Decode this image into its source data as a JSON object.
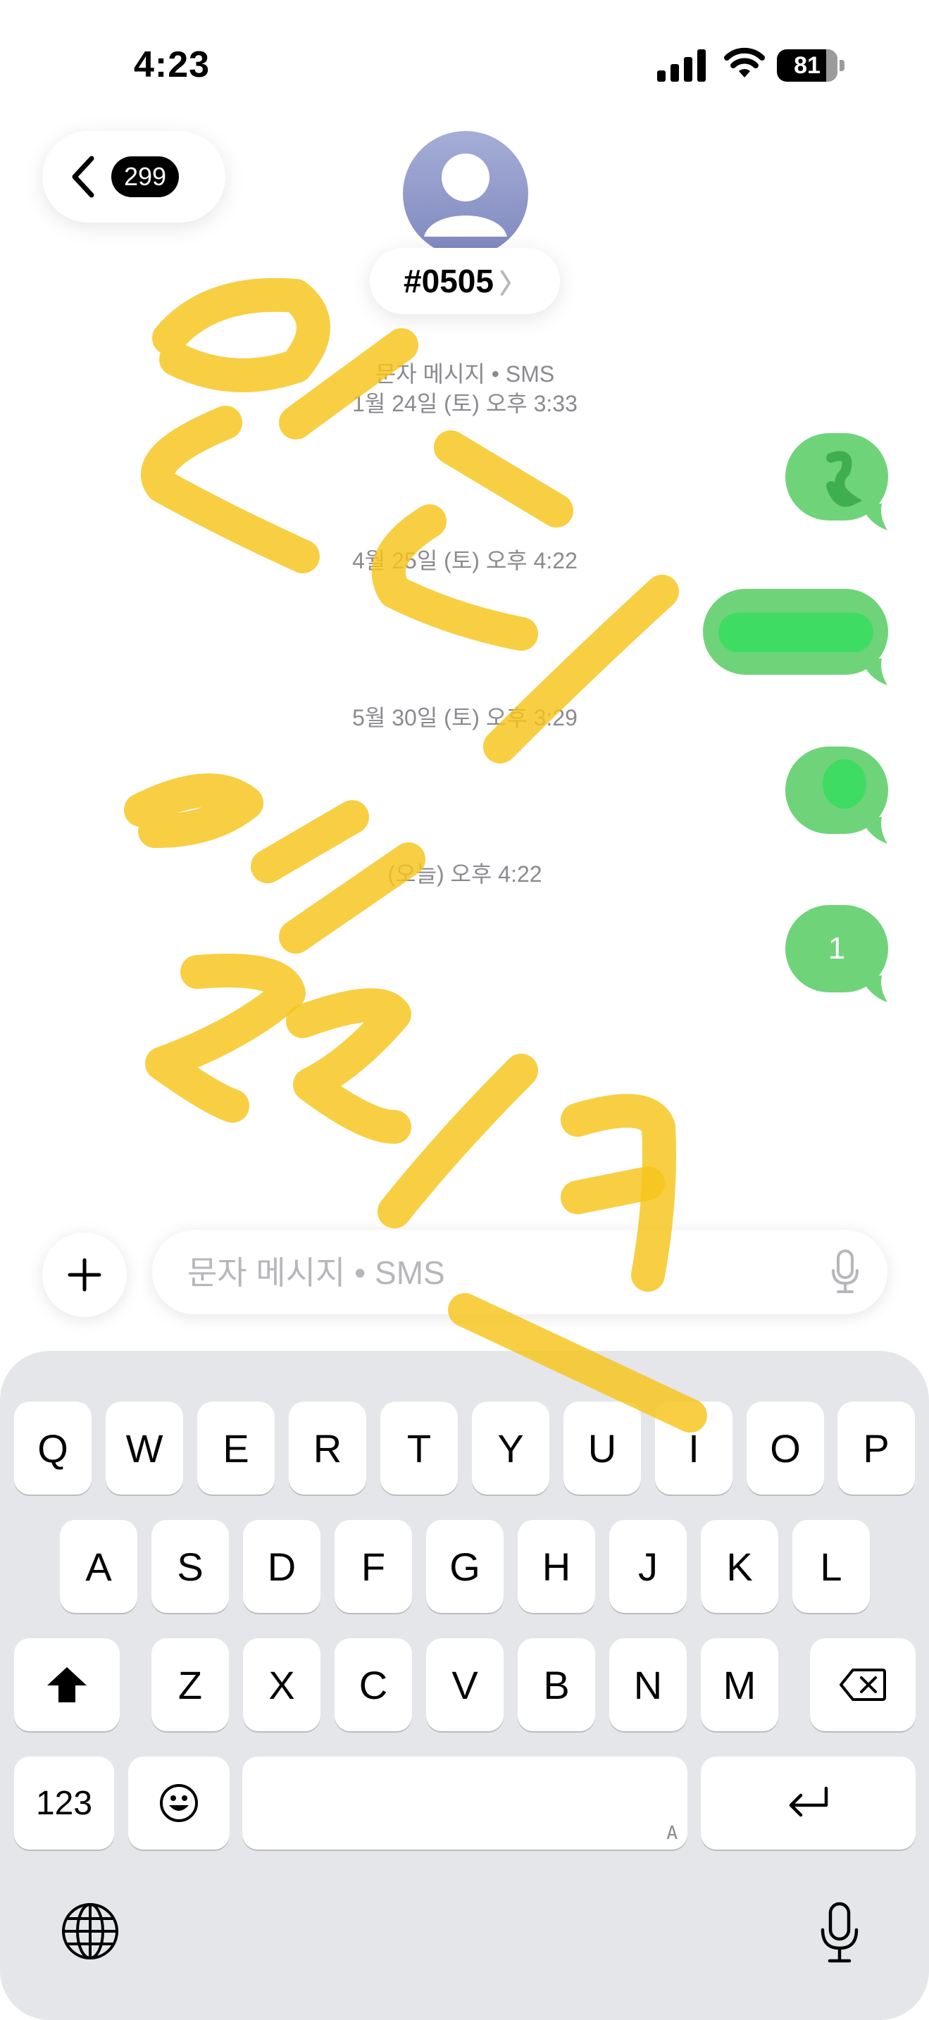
{
  "status_bar": {
    "time": "4:23",
    "battery_level": "81",
    "battery_fraction": 0.81
  },
  "header": {
    "back_badge_count": "299",
    "contact_name": "#0505",
    "contact_chevron": "〉"
  },
  "thread": {
    "timestamps": [
      {
        "line1": "문자 메시지 • SMS",
        "line2": "1월 24일 (토) 오후 3:33"
      },
      {
        "line1": "4월 25일 (토) 오후 4:22"
      },
      {
        "line1": "5월 30일 (토) 오후 3:29"
      },
      {
        "line1": "(오늘) 오후 4:22"
      }
    ],
    "messages": [
      {
        "text": "",
        "direction": "sent"
      },
      {
        "text": "",
        "direction": "sent"
      },
      {
        "text": "",
        "direction": "sent"
      },
      {
        "text": "1",
        "direction": "sent"
      }
    ],
    "bubble_color": "#6fd37a"
  },
  "composer": {
    "placeholder": "문자 메시지 • SMS"
  },
  "keyboard": {
    "row1": [
      "Q",
      "W",
      "E",
      "R",
      "T",
      "Y",
      "U",
      "I",
      "O",
      "P"
    ],
    "row2": [
      "A",
      "S",
      "D",
      "F",
      "G",
      "H",
      "J",
      "K",
      "L"
    ],
    "row3": [
      "Z",
      "X",
      "C",
      "V",
      "B",
      "N",
      "M"
    ],
    "numbers_key": "123",
    "space_hint": "A",
    "background": "#e5e6ea"
  },
  "icons": [
    "signal-icon",
    "wifi-icon",
    "battery-icon",
    "back-chevron-icon",
    "avatar-person-icon",
    "plus-icon",
    "microphone-icon",
    "shift-icon",
    "delete-icon",
    "emoji-icon",
    "return-icon",
    "globe-icon",
    "dictation-icon"
  ]
}
